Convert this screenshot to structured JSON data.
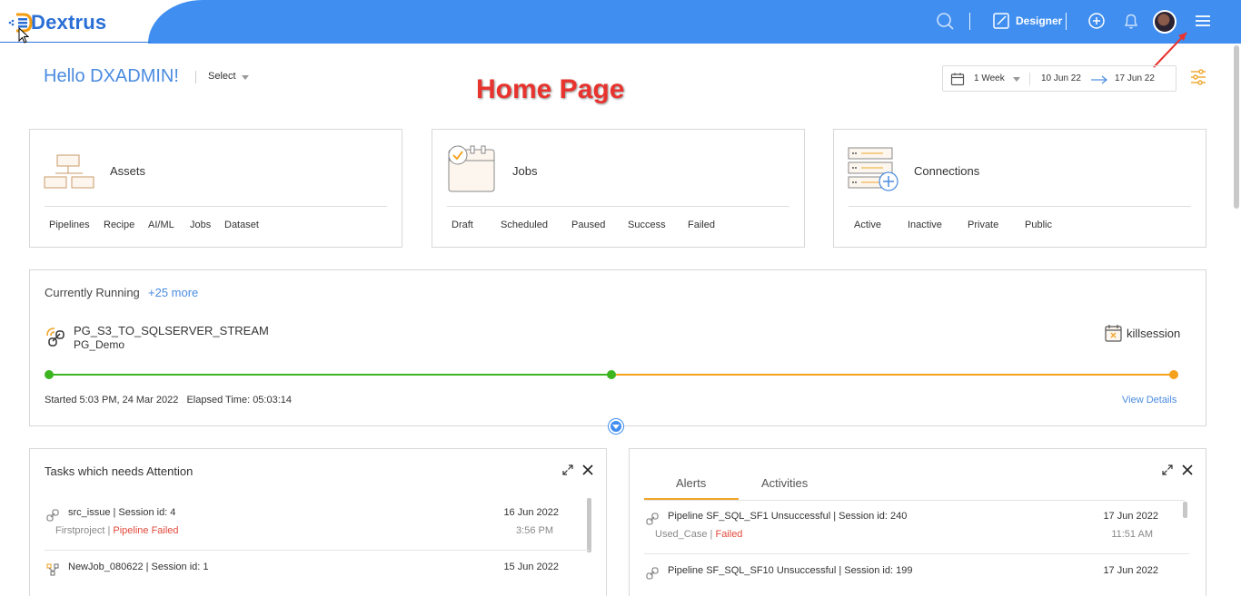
{
  "header": {
    "logo_text": "Dextrus",
    "designer_label": "Designer",
    "icons": [
      "search-icon",
      "designer-icon",
      "add-icon",
      "bell-icon",
      "avatar",
      "menu-icon"
    ],
    "accent_color": "#3f8ef0"
  },
  "greeting": {
    "text": "Hello DXADMIN!",
    "select_label": "Select"
  },
  "annotation": {
    "text": "Home Page"
  },
  "date_filter": {
    "range": "1 Week",
    "from": "10 Jun 22",
    "to": "17 Jun 22"
  },
  "cards": [
    {
      "title": "Assets",
      "items": [
        "Pipelines",
        "Recipe",
        "AI/ML",
        "Jobs",
        "Dataset"
      ]
    },
    {
      "title": "Jobs",
      "items": [
        "Draft",
        "Scheduled",
        "Paused",
        "Success",
        "Failed"
      ]
    },
    {
      "title": "Connections",
      "items": [
        "Active",
        "Inactive",
        "Private",
        "Public"
      ]
    }
  ],
  "running": {
    "title": "Currently Running",
    "more": "+25 more",
    "pipeline_name": "PG_S3_TO_SQLSERVER_STREAM",
    "project": "PG_Demo",
    "kill_label": "killsession",
    "started": "Started 5:03 PM, 24 Mar 2022",
    "elapsed": "Elapsed Time: 05:03:14",
    "view_details": "View Details",
    "colors": {
      "done": "#3cb521",
      "remaining": "#f5a11c"
    }
  },
  "tasks_panel": {
    "title": "Tasks which needs Attention",
    "rows": [
      {
        "name": "src_issue | Session id: 4",
        "project": "Firstproject",
        "status": "Pipeline Failed",
        "date": "16 Jun 2022",
        "time": "3:56 PM"
      },
      {
        "name": "NewJob_080622 | Session id: 1",
        "project": "",
        "status": "",
        "date": "15 Jun 2022",
        "time": ""
      }
    ]
  },
  "alerts_panel": {
    "tabs": [
      "Alerts",
      "Activities"
    ],
    "rows": [
      {
        "name": "Pipeline SF_SQL_SF1 Unsuccessful | Session id: 240",
        "project": "Used_Case",
        "status": "Failed",
        "date": "17 Jun 2022",
        "time": "11:51 AM"
      },
      {
        "name": "Pipeline SF_SQL_SF10 Unsuccessful | Session id: 199",
        "project": "",
        "status": "",
        "date": "17 Jun 2022",
        "time": ""
      }
    ]
  }
}
